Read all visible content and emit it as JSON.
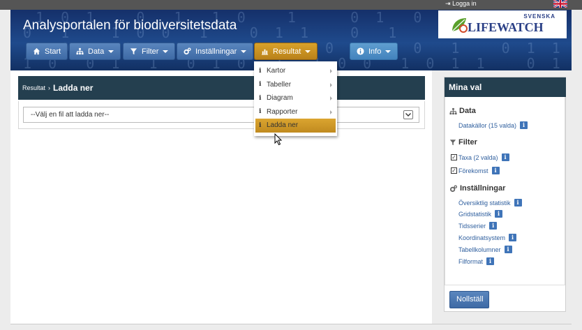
{
  "topbar": {
    "login_label": "Logga in",
    "language_flag": "uk-flag-icon"
  },
  "header": {
    "title": "Analysportalen för biodiversitetsdata",
    "logo": {
      "text_top": "SVENSKA",
      "text_main": "LIFEWATCH"
    }
  },
  "nav": {
    "start": {
      "label": "Start",
      "icon": "home-icon"
    },
    "data": {
      "label": "Data",
      "icon": "sitemap-icon"
    },
    "filter": {
      "label": "Filter",
      "icon": "filter-icon"
    },
    "settings": {
      "label": "Inställningar",
      "icon": "cogs-icon"
    },
    "result": {
      "label": "Resultat",
      "icon": "bar-chart-icon"
    },
    "info": {
      "label": "Info",
      "icon": "info-circle-icon"
    }
  },
  "dropdown": {
    "items": [
      {
        "label": "Kartor",
        "has_submenu": true
      },
      {
        "label": "Tabeller",
        "has_submenu": true
      },
      {
        "label": "Diagram",
        "has_submenu": true
      },
      {
        "label": "Rapporter",
        "has_submenu": true
      },
      {
        "label": "Ladda ner",
        "has_submenu": false,
        "selected": true
      }
    ]
  },
  "main": {
    "breadcrumb_parent": "Resultat",
    "breadcrumb_separator": "›",
    "breadcrumb_current": "Ladda ner",
    "select_value": "--Välj en fil att ladda ner--"
  },
  "sidebar": {
    "title": "Mina val",
    "data": {
      "heading": "Data",
      "items": [
        "Datakällor (15 valda)"
      ]
    },
    "filter": {
      "heading": "Filter",
      "items": [
        "Taxa (2 valda)",
        "Förekomst"
      ]
    },
    "settings": {
      "heading": "Inställningar",
      "items": [
        "Översiktlig statistik",
        "Gridstatistik",
        "Tidsserier",
        "Koordinatsystem",
        "Tabellkolumner",
        "Filformat"
      ]
    },
    "reset_label": "Nollställ"
  },
  "colors": {
    "nav_blue": "#4a76b0",
    "active_gold": "#c99020",
    "panel_dark": "#243f4f",
    "link_blue": "#2f5f9e"
  }
}
